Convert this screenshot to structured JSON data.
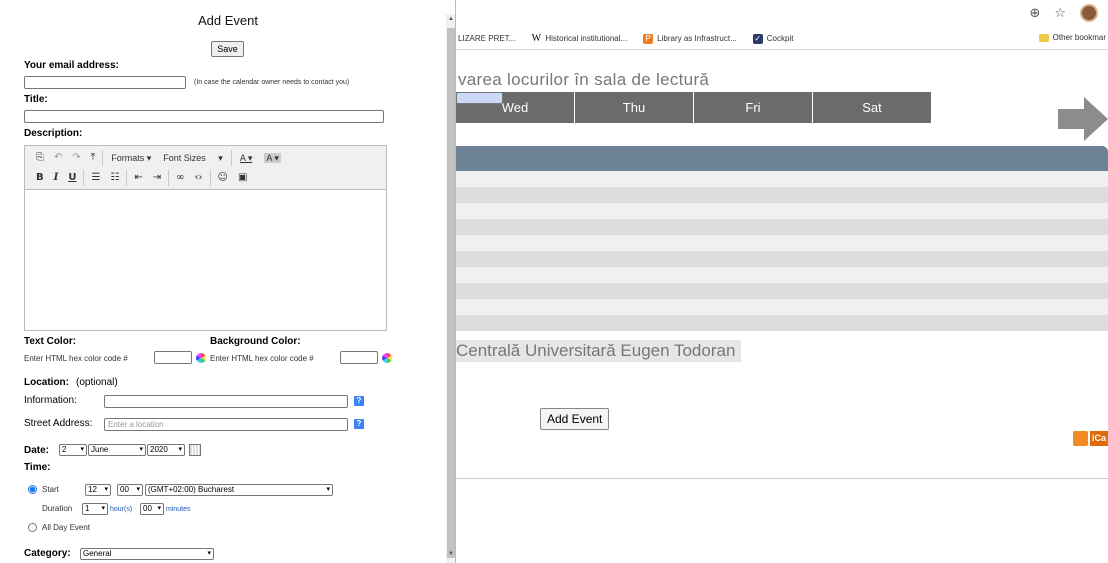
{
  "browser": {
    "zoom_icon": "zoom-icon",
    "star_icon": "star-icon",
    "bookmarks": [
      {
        "label": "LIZARE PRET...",
        "icon": ""
      },
      {
        "label": "Historical institutional...",
        "icon": "W"
      },
      {
        "label": "Library as Infrastruct...",
        "icon": "P"
      },
      {
        "label": "Cockpit",
        "icon": "✓"
      }
    ],
    "other_bookmarks": "Other bookmar"
  },
  "page": {
    "heading": "varea locurilor în sala de lectură",
    "days": [
      "",
      "Wed",
      "Thu",
      "Fri",
      "Sat"
    ],
    "library_name": "Centrală Universitară Eugen Todoran",
    "add_event_button": "Add Event",
    "ical": "iCa"
  },
  "dialog": {
    "title": "Add Event",
    "save": "Save",
    "email_label": "Your email address:",
    "email_value": "",
    "email_note": "(In case the calendar owner needs to contact you)",
    "title_label": "Title:",
    "title_value": "",
    "description_label": "Description:",
    "toolbar": {
      "formats": "Formats ▾",
      "font_sizes": "Font Sizes",
      "font_sizes_chev": "▾",
      "text_color": "A ▾",
      "bg_color": "A ▾"
    },
    "text_color_label": "Text Color:",
    "bg_color_label": "Background Color:",
    "hex_prompt_1": "Enter HTML hex color code #",
    "hex_prompt_2": "Enter HTML hex color code #",
    "location_label": "Location:",
    "location_optional": "(optional)",
    "information_label": "Information:",
    "street_label": "Street Address:",
    "street_placeholder": "Enter a location",
    "help": "?",
    "date_label": "Date:",
    "date": {
      "day": "2",
      "month": "June",
      "year": "2020"
    },
    "time_label": "Time:",
    "start_label": "Start",
    "hour": "12",
    "minute": "00",
    "timezone": "(GMT+02:00) Bucharest",
    "duration_label": "Duration",
    "duration_hours": "1",
    "hours_unit": "hour(s)",
    "duration_minutes": "00",
    "minutes_unit": "minutes",
    "all_day_label": "All Day Event",
    "start_selected": true,
    "category_label": "Category:",
    "category_value": "General"
  },
  "colors": {
    "day_header": "#6b6b6b",
    "cal_header": "#6e8296",
    "link": "#1a5bb5",
    "radio_selected": "#1a73e8"
  }
}
